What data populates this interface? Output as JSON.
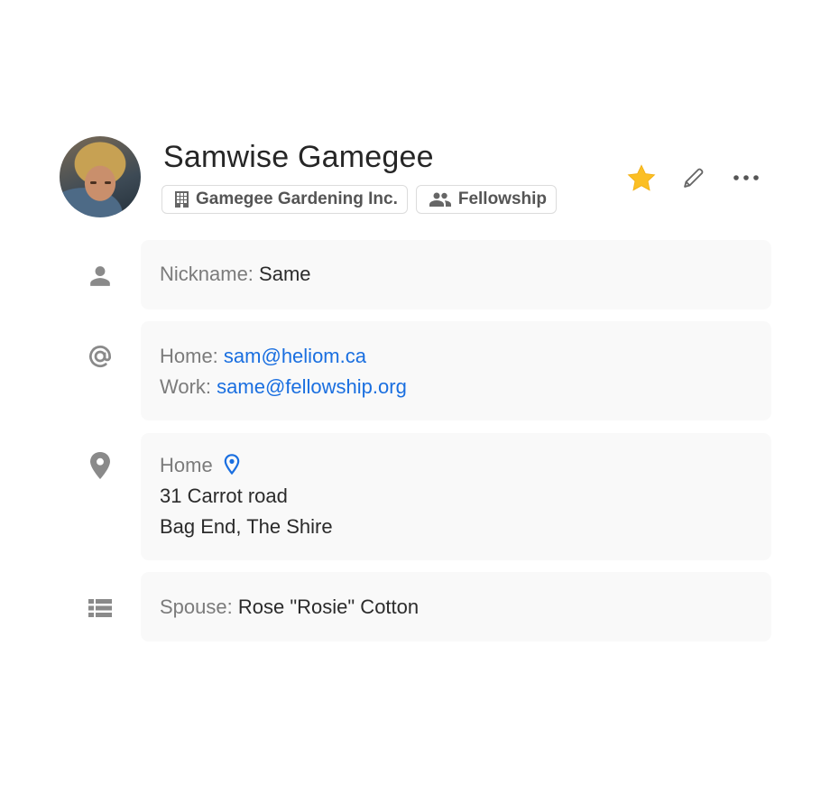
{
  "contact": {
    "name": "Samwise Gamegee",
    "chips": [
      {
        "icon": "building-icon",
        "label": "Gamegee Gardening Inc."
      },
      {
        "icon": "group-icon",
        "label": "Fellowship"
      }
    ],
    "actions": {
      "favorite": {
        "icon": "star-icon",
        "active": true,
        "color": "#FBBF24"
      },
      "edit": {
        "icon": "pencil-icon"
      },
      "more": {
        "icon": "more-horizontal-icon"
      }
    }
  },
  "sections": {
    "nickname": {
      "label": "Nickname:",
      "value": "Same"
    },
    "emails": [
      {
        "label": "Home:",
        "value": "sam@heliom.ca"
      },
      {
        "label": "Work:",
        "value": "same@fellowship.org"
      }
    ],
    "address": {
      "label": "Home",
      "line1": "31 Carrot road",
      "line2": "Bag End, The Shire"
    },
    "custom": {
      "label": "Spouse:",
      "value": "Rose \"Rosie\" Cotton"
    }
  },
  "colors": {
    "accent_link": "#1A6FE0",
    "star": "#FBBF24",
    "card_bg": "#F9F9F9",
    "icon_gray": "#8A8A8A"
  }
}
